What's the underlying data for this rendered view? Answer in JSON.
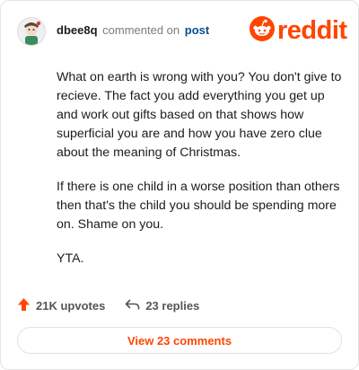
{
  "comment": {
    "username": "dbee8q",
    "action_text": "commented on",
    "post_link": "post",
    "body": [
      "What on earth is wrong with you? You don't give to recieve. The fact you add everything you get up and work out gifts based on that shows how superficial you are and how you have zero clue about the meaning of Christmas.",
      "If there is one child in a worse position than others then that's the child you should be spending more on. Shame on you.",
      "YTA."
    ]
  },
  "brand": {
    "name": "reddit",
    "color": "#ff4500"
  },
  "actions": {
    "upvotes": "21K upvotes",
    "replies": "23 replies"
  },
  "view_comments_label": "View 23 comments",
  "icons": [
    "user-avatar",
    "reddit-snoo-icon",
    "upvote-arrow-icon",
    "reply-arrow-icon"
  ]
}
